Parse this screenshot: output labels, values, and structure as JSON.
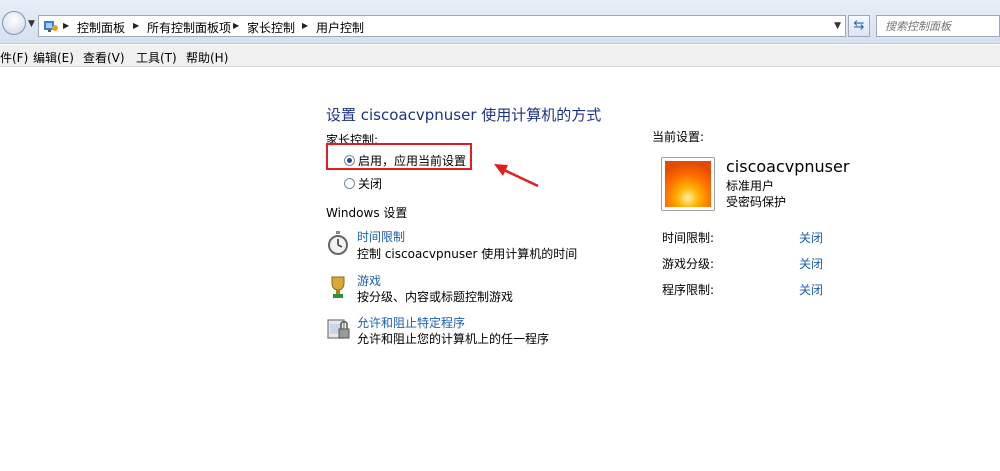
{
  "address_bar": {
    "breadcrumbs": [
      "控制面板",
      "所有控制面板项",
      "家长控制",
      "用户控制"
    ],
    "search_placeholder": "搜索控制面板"
  },
  "menu": [
    {
      "label": "件(F)"
    },
    {
      "label": "编辑(E)"
    },
    {
      "label": "查看(V)"
    },
    {
      "label": "工具(T)"
    },
    {
      "label": "帮助(H)"
    }
  ],
  "main": {
    "title": "设置 ciscoacvpnuser 使用计算机的方式",
    "parental_controls_label": "家长控制:",
    "options": [
      {
        "label": "启用，应用当前设置",
        "selected": true
      },
      {
        "label": "关闭",
        "selected": false
      }
    ],
    "windows_settings_label": "Windows 设置",
    "settings": [
      {
        "icon": "stopwatch-icon",
        "link": "时间限制",
        "desc": "控制 ciscoacvpnuser 使用计算机的时间"
      },
      {
        "icon": "game-trophy-icon",
        "link": "游戏",
        "desc": "按分级、内容或标题控制游戏"
      },
      {
        "icon": "program-block-icon",
        "link": "允许和阻止特定程序",
        "desc": "允许和阻止您的计算机上的任一程序"
      }
    ]
  },
  "current": {
    "label": "当前设置:",
    "user": {
      "name": "ciscoacvpnuser",
      "account_type": "标准用户",
      "password_status": "受密码保护"
    },
    "rows": [
      {
        "label": "时间限制:",
        "value": "关闭"
      },
      {
        "label": "游戏分级:",
        "value": "关闭"
      },
      {
        "label": "程序限制:",
        "value": "关闭"
      }
    ]
  },
  "colors": {
    "title": "#1e3287",
    "link": "#1a5fb4",
    "highlight_box": "#e02020"
  }
}
